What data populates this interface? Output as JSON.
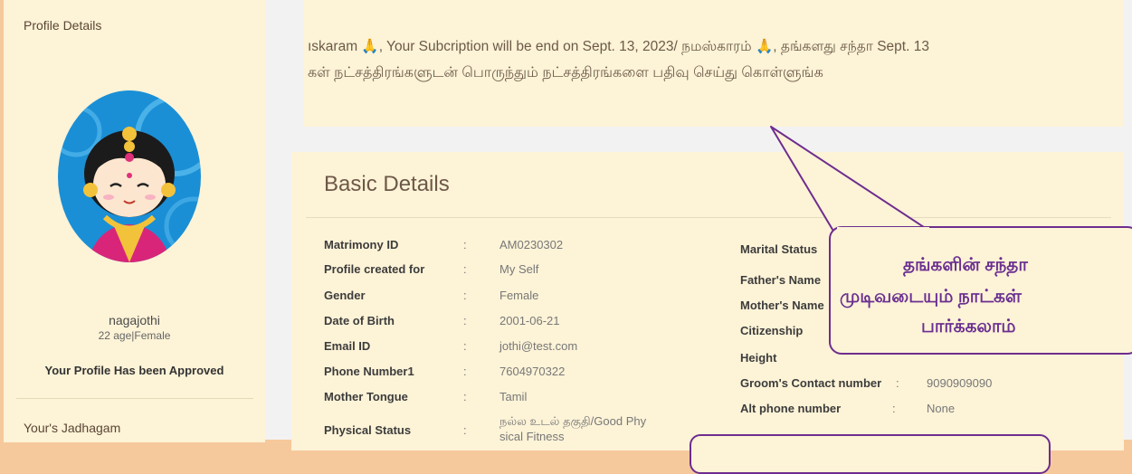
{
  "sidebar": {
    "title": "Profile Details",
    "name": "nagajothi",
    "age_gender": "22 age|Female",
    "approved": "Your Profile Has been Approved",
    "jadhagam_link": "Your's Jadhagam"
  },
  "notice": {
    "line1": "ıskaram 🙏, Your Subcription will be end on Sept. 13, 2023/ நமஸ்காரம் 🙏, தங்களது சந்தா Sept. 13",
    "line2": "கள் நட்சத்திரங்களுடன் பொருந்தும் நட்சத்திரங்களை பதிவு செய்து கொள்ளுங்க"
  },
  "basic": {
    "title": "Basic Details",
    "left": [
      {
        "label": "Matrimony ID",
        "value": "AM0230302"
      },
      {
        "label": "Profile created for",
        "value": "My Self"
      },
      {
        "label": "Gender",
        "value": "Female"
      },
      {
        "label": "Date of Birth",
        "value": "2001-06-21"
      },
      {
        "label": "Email ID",
        "value": "jothi@test.com"
      },
      {
        "label": "Phone Number1",
        "value": "7604970322"
      },
      {
        "label": "Mother Tongue",
        "value": "Tamil"
      },
      {
        "label": "Physical Status",
        "value": "நல்ல உடல் தகுதி/Good Phy",
        "value2": "sical Fitness"
      }
    ],
    "right": [
      {
        "label": "Marital Status",
        "value": ""
      },
      {
        "label": "Father's Name",
        "value": ""
      },
      {
        "label": "Mother's Name",
        "value": ""
      },
      {
        "label": "Citizenship",
        "value": ""
      },
      {
        "label": "Height",
        "value": ""
      },
      {
        "label": "Groom's Contact number",
        "value": "9090909090"
      },
      {
        "label": "Alt phone number",
        "value": "None"
      }
    ],
    "colon": ":"
  },
  "callout": {
    "line1": "தங்களின் சந்தா",
    "line2": "முடிவடையும் நாட்கள்",
    "line3": "பார்க்கலாம்"
  }
}
